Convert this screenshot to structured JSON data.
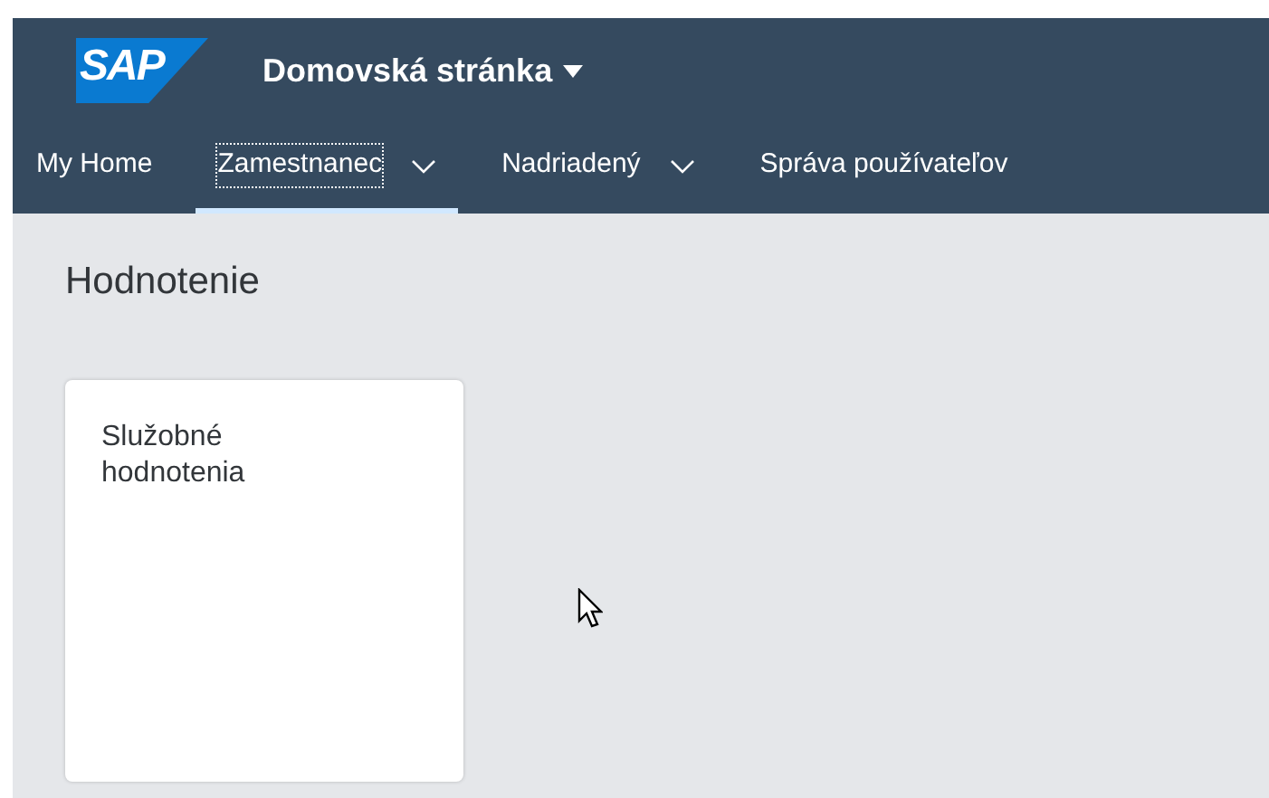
{
  "header": {
    "logo": "SAP",
    "title": "Domovská stránka"
  },
  "tabs": [
    {
      "label": "My Home",
      "selected": false,
      "has_menu": false
    },
    {
      "label": "Zamestnanec",
      "selected": true,
      "has_menu": true
    },
    {
      "label": "Nadriadený",
      "selected": false,
      "has_menu": true
    },
    {
      "label": "Správa používateľov",
      "selected": false,
      "has_menu": false
    }
  ],
  "section": {
    "title": "Hodnotenie",
    "tiles": [
      {
        "title": "Služobné hodnotenia"
      }
    ]
  }
}
